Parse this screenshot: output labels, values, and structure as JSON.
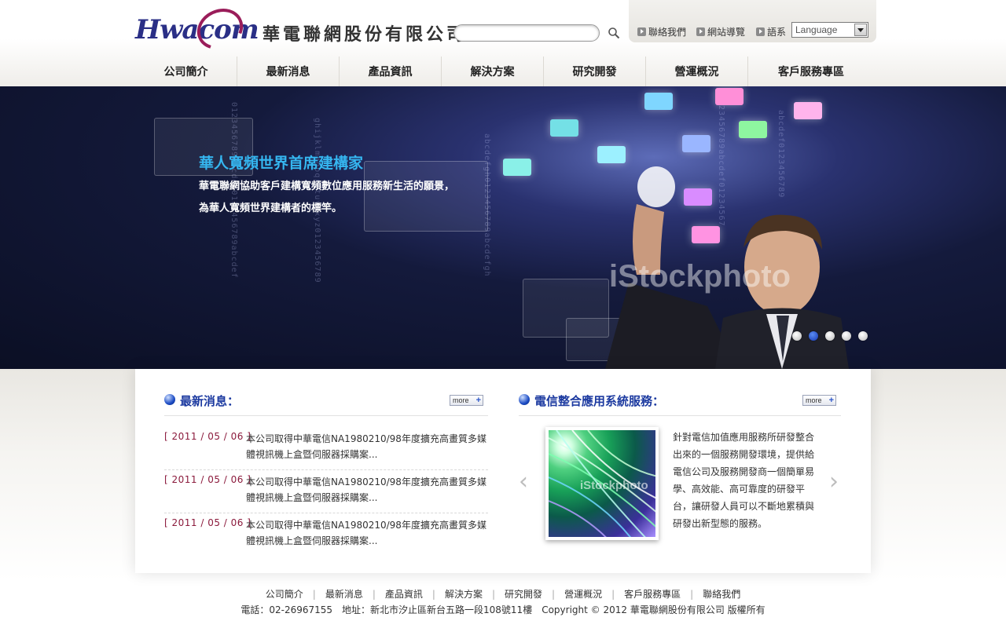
{
  "header": {
    "logo_text": "Hwacom",
    "company_name": "華電聯網股份有限公司",
    "search": {
      "placeholder": "",
      "value": ""
    },
    "util_links": [
      "聯絡我們",
      "網站導覽",
      "語系"
    ],
    "language_select": "Language"
  },
  "nav": {
    "items": [
      "公司簡介",
      "最新消息",
      "產品資訊",
      "解決方案",
      "研究開發",
      "營運概況",
      "客戶服務專區"
    ]
  },
  "banner": {
    "title": "華人寬頻世界首席建構家",
    "line1": "華電聯網協助客戶建構寬頻數位應用服務新生活的願景，",
    "line2": "為華人寬頻世界建構者的標竿。",
    "watermark": "iStockphoto",
    "slide_count": 5,
    "active_slide": 2
  },
  "news": {
    "title": "最新消息：",
    "more_label": "more",
    "items": [
      {
        "date": "[ 2011 / 05 / 06 ]",
        "text": "本公司取得中華電信NA1980210/98年度擴充高畫質多媒體視訊機上盒暨伺服器採購案..."
      },
      {
        "date": "[ 2011 / 05 / 06 ]",
        "text": "本公司取得中華電信NA1980210/98年度擴充高畫質多媒體視訊機上盒暨伺服器採購案..."
      },
      {
        "date": "[ 2011 / 05 / 06 ]",
        "text": "本公司取得中華電信NA1980210/98年度擴充高畫質多媒體視訊機上盒暨伺服器採購案..."
      }
    ]
  },
  "service": {
    "title": "電信整合應用系統服務：",
    "more_label": "more",
    "prev_icon": "‹",
    "next_icon": "›",
    "image_watermark": "iStockphoto",
    "description": "針對電信加值應用服務所研發整合出來的一個服務開發環境，提供給電信公司及服務開發商一個簡單易學、高效能、高可靠度的研發平台，讓研發人員可以不斷地累積與研發出新型態的服務。"
  },
  "footer": {
    "links": [
      "公司簡介",
      "最新消息",
      "產品資訊",
      "解決方案",
      "研究開發",
      "營運概況",
      "客戶服務專區",
      "聯絡我們"
    ],
    "info": "電話：02-26967155　地址：新北市汐止區新台五路一段108號11樓　Copyright © 2012 華電聯網股份有限公司 版權所有"
  },
  "colors": {
    "brand": "#2a2f86",
    "accent": "#9a1d5a",
    "section_title": "#1c3aa0",
    "banner_title": "#35b6f0",
    "news_date": "#8b1a3c"
  }
}
